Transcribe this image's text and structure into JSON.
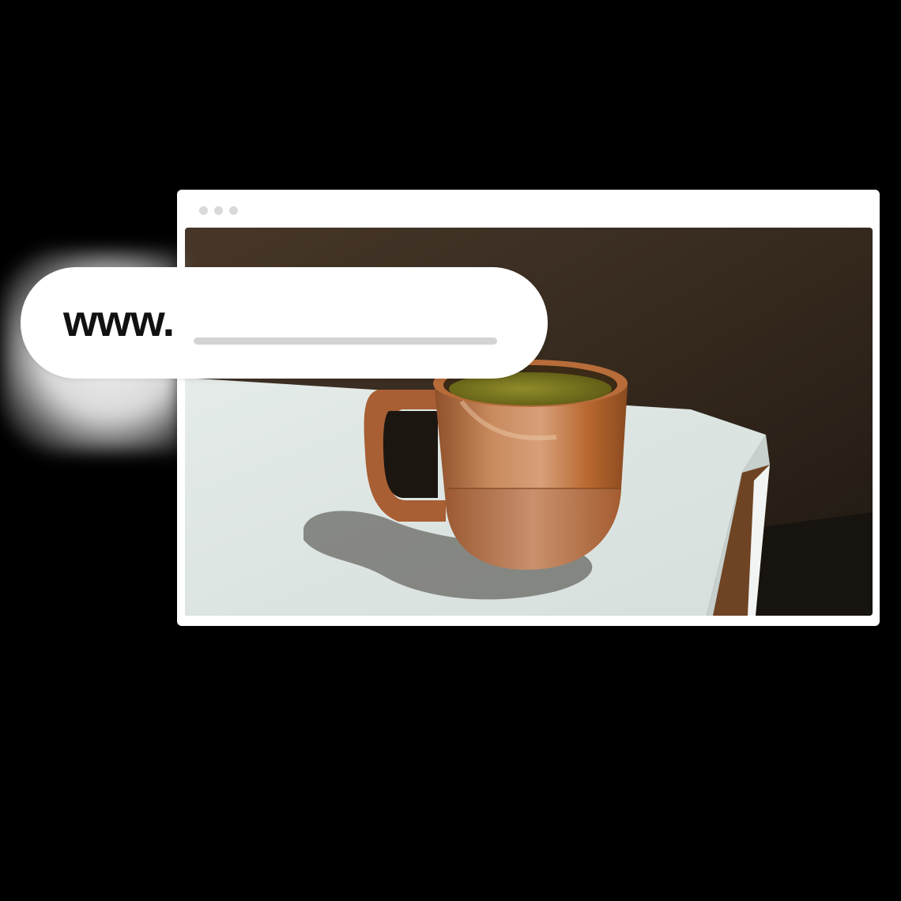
{
  "browser": {
    "window_controls": [
      "dot",
      "dot",
      "dot"
    ],
    "content": {
      "photo_subject": "ceramic-mug-with-green-tea",
      "colors": {
        "wall": "#3b2c1e",
        "table_top": "#e6ecea",
        "mug": "#b46a3c",
        "tea": "#7a7a1e"
      }
    }
  },
  "url_bar": {
    "prefix": "www."
  }
}
